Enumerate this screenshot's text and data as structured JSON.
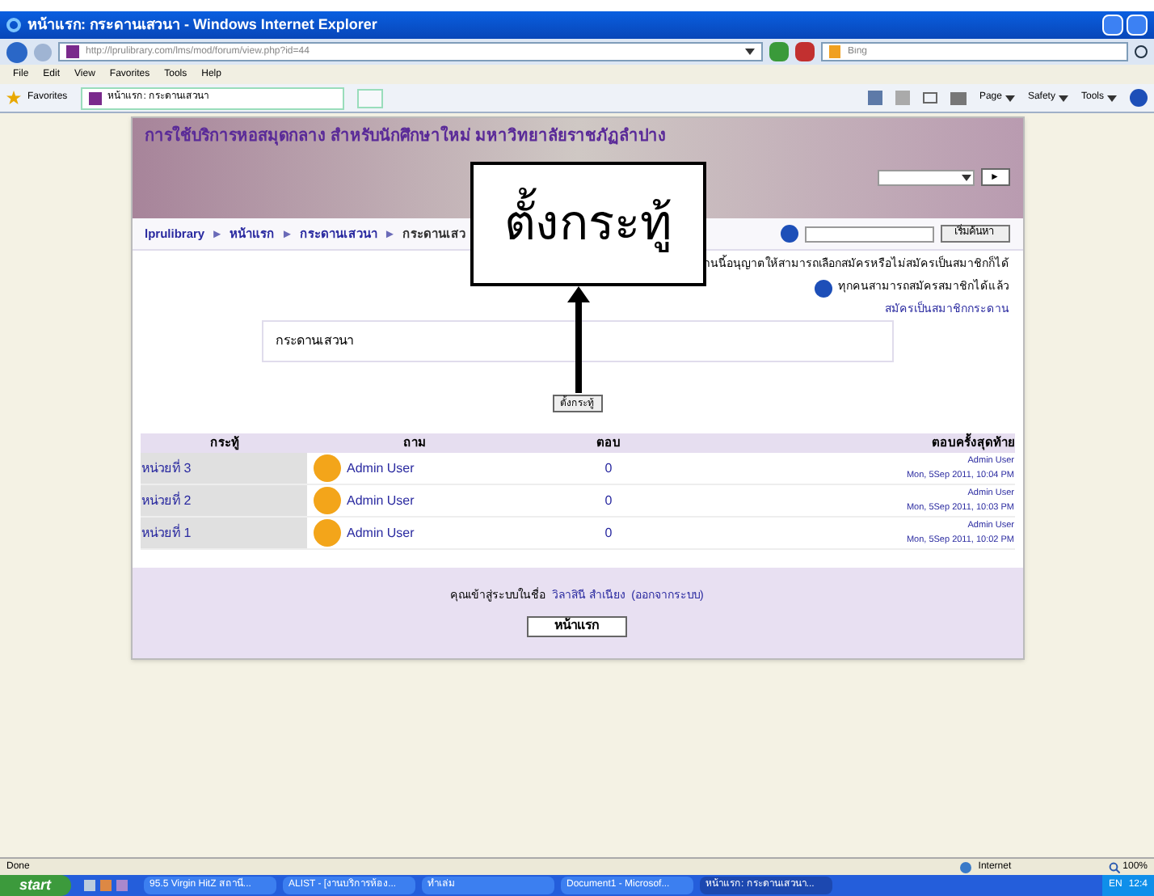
{
  "window": {
    "title": "หน้าแรก: กระดานเสวนา - Windows Internet Explorer"
  },
  "address_bar": {
    "url": "http://lprulibrary.com/lms/mod/forum/view.php?id=44",
    "search_placeholder": "Bing"
  },
  "menu": [
    "File",
    "Edit",
    "View",
    "Favorites",
    "Tools",
    "Help"
  ],
  "favorites_bar": {
    "favorites": "Favorites",
    "tab": "หน้าแรก: กระดานเสวนา",
    "commands": [
      "Page",
      "Safety",
      "Tools"
    ]
  },
  "page": {
    "site_title": "การใช้บริการหอสมุดกลาง สำหรับนักศึกษาใหม่ มหาวิทยาลัยราชภัฏลำปาง",
    "go_button": "►",
    "breadcrumb": [
      "lprulibrary",
      "หน้าแรก",
      "กระดานเสวนา",
      "กระดานเสว"
    ],
    "breadcrumb_separator": "►",
    "search_button": "เริ่มค้นหา",
    "subscribe_note": "านนี้อนุญาตให้สามารถเลือกสมัครหรือไม่สมัครเป็นสมาชิกก็ได้",
    "subscribe_info": "ทุกคนสามารถสมัครสมาชิกได้แล้ว",
    "subscribe_link": "สมัครเป็นสมาชิกกระดาน",
    "intro": "กระดานเสวนา",
    "new_topic_button": "ตั้งกระทู้",
    "table": {
      "columns": [
        "กระทู้",
        "ถาม",
        "ตอบ",
        "ตอบครั้งสุดท้าย"
      ],
      "rows": [
        {
          "topic": "หน่วยที่ 3",
          "author": "Admin User",
          "replies": "0",
          "last_by": "Admin User",
          "last_date": "Mon, 5Sep 2011, 10:04 PM"
        },
        {
          "topic": "หน่วยที่ 2",
          "author": "Admin User",
          "replies": "0",
          "last_by": "Admin User",
          "last_date": "Mon, 5Sep 2011, 10:03 PM"
        },
        {
          "topic": "หน่วยที่ 1",
          "author": "Admin User",
          "replies": "0",
          "last_by": "Admin User",
          "last_date": "Mon, 5Sep 2011, 10:02 PM"
        }
      ]
    },
    "login_text": "คุณเข้าสู่ระบบในชื่อ",
    "login_name": "วิลาสินี สำเนียง",
    "logout": "(ออกจากระบบ)",
    "home_button": "หน้าแรก"
  },
  "callout": {
    "text": "ตั้งกระทู้"
  },
  "status_bar": {
    "status": "Done",
    "zone": "Internet",
    "zoom": "100%"
  },
  "taskbar": {
    "start": "start",
    "items": [
      {
        "label": "95.5 Virgin HitZ สถานี...",
        "selected": false
      },
      {
        "label": "ALIST - [งานบริการห้อง...",
        "selected": false
      },
      {
        "label": "ทำเล่ม",
        "selected": false
      },
      {
        "label": "Document1 - Microsof...",
        "selected": false
      },
      {
        "label": "หน้าแรก: กระดานเสวนา...",
        "selected": true
      }
    ],
    "lang": "EN",
    "clock": "12:4"
  }
}
